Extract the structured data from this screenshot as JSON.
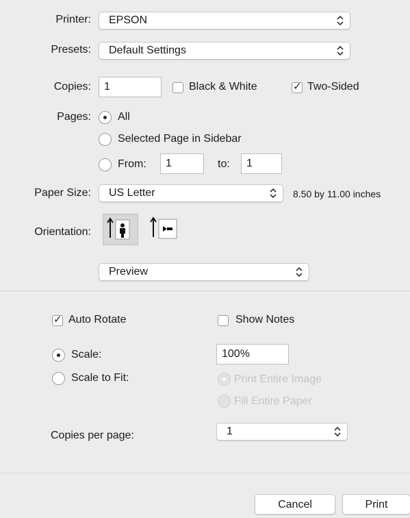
{
  "printer": {
    "label": "Printer:",
    "value": "EPSON"
  },
  "presets": {
    "label": "Presets:",
    "value": "Default Settings"
  },
  "copies": {
    "label": "Copies:",
    "value": "1",
    "bw_label": "Black & White",
    "bw_checked": false,
    "two_sided_label": "Two-Sided",
    "two_sided_checked": true
  },
  "pages": {
    "label": "Pages:",
    "all_label": "All",
    "sidebar_label": "Selected Page in Sidebar",
    "from_label": "From:",
    "from_value": "1",
    "to_label": "to:",
    "to_value": "1",
    "selected": "All"
  },
  "paper_size": {
    "label": "Paper Size:",
    "value": "US Letter",
    "dimensions": "8.50 by 11.00 inches"
  },
  "orientation": {
    "label": "Orientation:",
    "options": [
      "portrait-icon",
      "landscape-icon"
    ],
    "selected": "portrait"
  },
  "section": {
    "value": "Preview"
  },
  "preview": {
    "auto_rotate_label": "Auto Rotate",
    "auto_rotate_checked": true,
    "show_notes_label": "Show Notes",
    "show_notes_checked": false,
    "scale_label": "Scale:",
    "scale_value": "100%",
    "scale_to_fit_label": "Scale to Fit:",
    "print_entire_label": "Print Entire Image",
    "fill_entire_label": "Fill Entire Paper",
    "copies_per_page_label": "Copies per page:",
    "copies_per_page_value": "1"
  },
  "buttons": {
    "cancel": "Cancel",
    "print": "Print"
  }
}
